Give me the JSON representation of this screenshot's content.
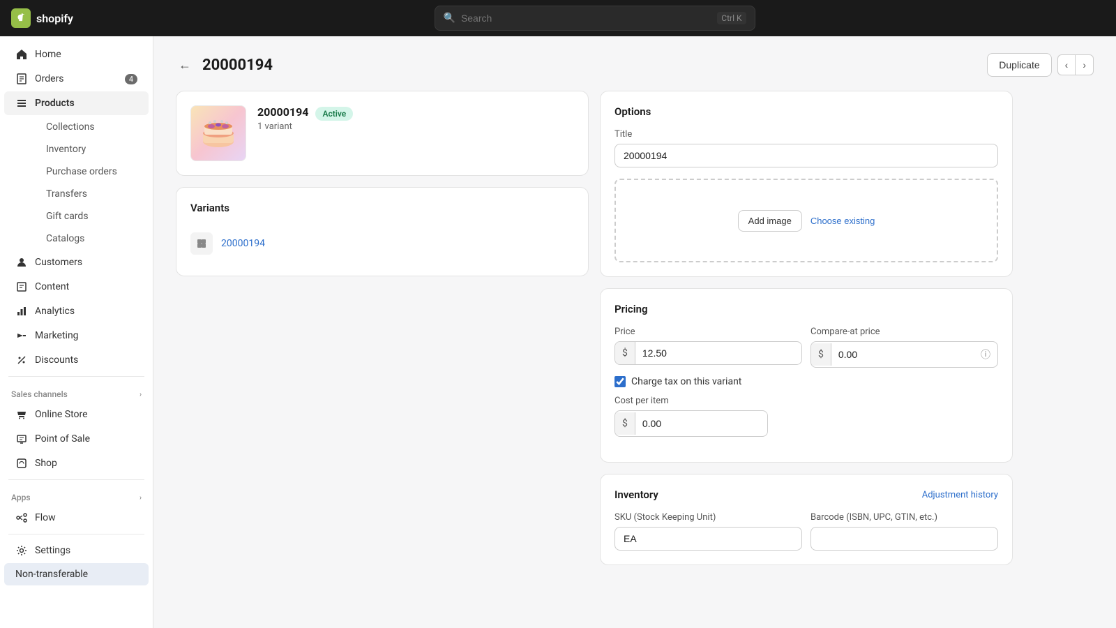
{
  "topbar": {
    "logo_text": "shopify",
    "search_placeholder": "Search",
    "search_shortcut": "Ctrl K"
  },
  "sidebar": {
    "items": [
      {
        "id": "home",
        "label": "Home",
        "icon": "home-icon",
        "active": false
      },
      {
        "id": "orders",
        "label": "Orders",
        "icon": "orders-icon",
        "badge": "4",
        "active": false
      },
      {
        "id": "products",
        "label": "Products",
        "icon": "products-icon",
        "active": true
      },
      {
        "id": "collections",
        "label": "Collections",
        "icon": null,
        "sub": true,
        "active": false
      },
      {
        "id": "inventory",
        "label": "Inventory",
        "icon": null,
        "sub": true,
        "active": false
      },
      {
        "id": "purchase-orders",
        "label": "Purchase orders",
        "icon": null,
        "sub": true,
        "active": false
      },
      {
        "id": "transfers",
        "label": "Transfers",
        "icon": null,
        "sub": true,
        "active": false
      },
      {
        "id": "gift-cards",
        "label": "Gift cards",
        "icon": null,
        "sub": true,
        "active": false
      },
      {
        "id": "catalogs",
        "label": "Catalogs",
        "icon": null,
        "sub": true,
        "active": false
      },
      {
        "id": "customers",
        "label": "Customers",
        "icon": "customers-icon",
        "active": false
      },
      {
        "id": "content",
        "label": "Content",
        "icon": "content-icon",
        "active": false
      },
      {
        "id": "analytics",
        "label": "Analytics",
        "icon": "analytics-icon",
        "active": false
      },
      {
        "id": "marketing",
        "label": "Marketing",
        "icon": "marketing-icon",
        "active": false
      },
      {
        "id": "discounts",
        "label": "Discounts",
        "icon": "discounts-icon",
        "active": false
      }
    ],
    "sales_channels_label": "Sales channels",
    "sales_channels": [
      {
        "id": "online-store",
        "label": "Online Store",
        "icon": "store-icon"
      },
      {
        "id": "point-of-sale",
        "label": "Point of Sale",
        "icon": "pos-icon"
      },
      {
        "id": "shop",
        "label": "Shop",
        "icon": "shop-icon"
      }
    ],
    "apps_label": "Apps",
    "apps": [
      {
        "id": "flow",
        "label": "Flow",
        "icon": "flow-icon"
      }
    ],
    "settings": {
      "label": "Settings",
      "icon": "settings-icon"
    },
    "non_transferable": {
      "label": "Non-transferable"
    }
  },
  "page": {
    "back_label": "←",
    "title": "20000194",
    "duplicate_label": "Duplicate",
    "nav_prev": "‹",
    "nav_next": "›"
  },
  "product_card": {
    "id": "20000194",
    "status": "Active",
    "variant_count": "1 variant"
  },
  "variants_card": {
    "title": "Variants",
    "variant_link": "20000194"
  },
  "options_card": {
    "title": "Options",
    "title_label": "Title",
    "title_value": "20000194",
    "add_image_label": "Add image",
    "choose_existing_label": "Choose existing"
  },
  "pricing_card": {
    "title": "Pricing",
    "price_label": "Price",
    "price_currency": "$",
    "price_value": "12.50",
    "compare_label": "Compare-at price",
    "compare_currency": "$",
    "compare_value": "0.00",
    "charge_tax_label": "Charge tax on this variant",
    "cost_label": "Cost per item",
    "cost_currency": "$",
    "cost_value": "0.00"
  },
  "inventory_card": {
    "title": "Inventory",
    "adjustment_label": "Adjustment history",
    "sku_label": "SKU (Stock Keeping Unit)",
    "sku_value": "EA",
    "barcode_label": "Barcode (ISBN, UPC, GTIN, etc.)",
    "barcode_value": ""
  }
}
